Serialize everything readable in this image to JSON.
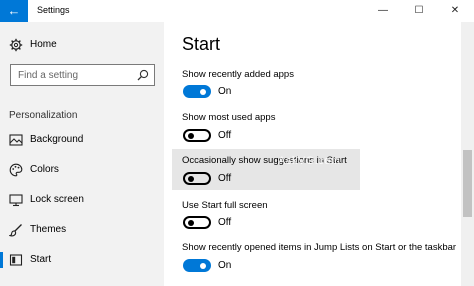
{
  "window": {
    "title": "Settings",
    "back_glyph": "←",
    "minimize_glyph": "—",
    "maximize_glyph": "☐",
    "close_glyph": "✕"
  },
  "sidebar": {
    "home_label": "Home",
    "search_placeholder": "Find a setting",
    "section_label": "Personalization",
    "items": [
      {
        "label": "Background",
        "icon": "image-icon"
      },
      {
        "label": "Colors",
        "icon": "palette-icon"
      },
      {
        "label": "Lock screen",
        "icon": "monitor-icon"
      },
      {
        "label": "Themes",
        "icon": "brush-icon"
      },
      {
        "label": "Start",
        "icon": "start-icon"
      }
    ]
  },
  "main": {
    "title": "Start",
    "settings": [
      {
        "label": "Show recently added apps",
        "state": "On"
      },
      {
        "label": "Show most used apps",
        "state": "Off"
      },
      {
        "label": "Occasionally show suggestions in Start",
        "state": "Off"
      },
      {
        "label": "Use Start full screen",
        "state": "Off"
      },
      {
        "label": "Show recently opened items in Jump Lists on Start or the taskbar",
        "state": "On"
      }
    ]
  },
  "watermark": "AskVG.com",
  "colors": {
    "accent": "#0078d7",
    "sidebar_bg": "#f2f2f2",
    "highlight_bg": "#e6e6e6"
  }
}
